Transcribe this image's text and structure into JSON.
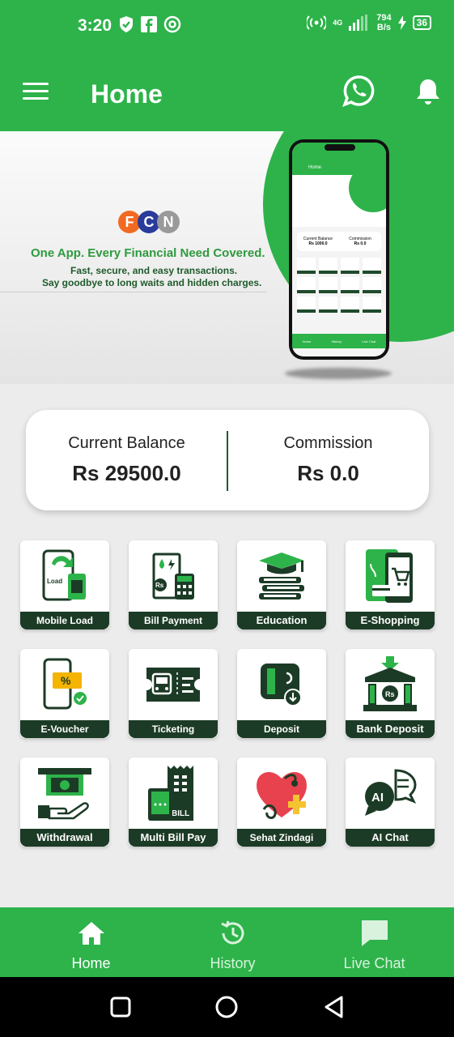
{
  "status_bar": {
    "time": "3:20",
    "network_label": "4G",
    "speed_value": "794",
    "speed_unit": "B/s",
    "battery": "36"
  },
  "app_bar": {
    "title": "Home"
  },
  "banner": {
    "logo_letters": [
      "F",
      "C",
      "N"
    ],
    "headline": "One App. Every Financial Need Covered.",
    "subline1": "Fast, secure, and easy transactions.",
    "subline2": "Say goodbye to long waits and hidden charges.",
    "phone_title": "Home",
    "phone_balance_label": "Current Balance",
    "phone_balance_value": "Rs 1000.0",
    "phone_commission_label": "Commission",
    "phone_commission_value": "Rs 0.0",
    "phone_nav": [
      "Home",
      "History",
      "Live Chat"
    ]
  },
  "balance": {
    "current_label": "Current Balance",
    "current_value": "Rs 29500.0",
    "commission_label": "Commission",
    "commission_value": "Rs 0.0"
  },
  "services": [
    {
      "label": "Mobile Load",
      "icon": "mobile-load-icon"
    },
    {
      "label": "Bill  Payment",
      "icon": "bill-payment-icon"
    },
    {
      "label": "Education",
      "icon": "education-icon"
    },
    {
      "label": "E-Shopping",
      "icon": "e-shopping-icon"
    },
    {
      "label": "E-Voucher",
      "icon": "e-voucher-icon"
    },
    {
      "label": "Ticketing",
      "icon": "ticketing-icon"
    },
    {
      "label": "Deposit",
      "icon": "deposit-icon"
    },
    {
      "label": "Bank Deposit",
      "icon": "bank-deposit-icon"
    },
    {
      "label": "Withdrawal",
      "icon": "withdrawal-icon"
    },
    {
      "label": "Multi Bill Pay",
      "icon": "multi-bill-pay-icon"
    },
    {
      "label": "Sehat Zindagi",
      "icon": "sehat-zindagi-icon"
    },
    {
      "label": "AI Chat",
      "icon": "ai-chat-icon"
    }
  ],
  "icon_text": {
    "load": "Load",
    "rs": "Rs",
    "bill": "BILL",
    "ai": "AI"
  },
  "bottom_nav": {
    "home": "Home",
    "history": "History",
    "live_chat": "Live Chat"
  },
  "colors": {
    "primary_green": "#2db34a",
    "dark_green": "#1c3b26"
  }
}
